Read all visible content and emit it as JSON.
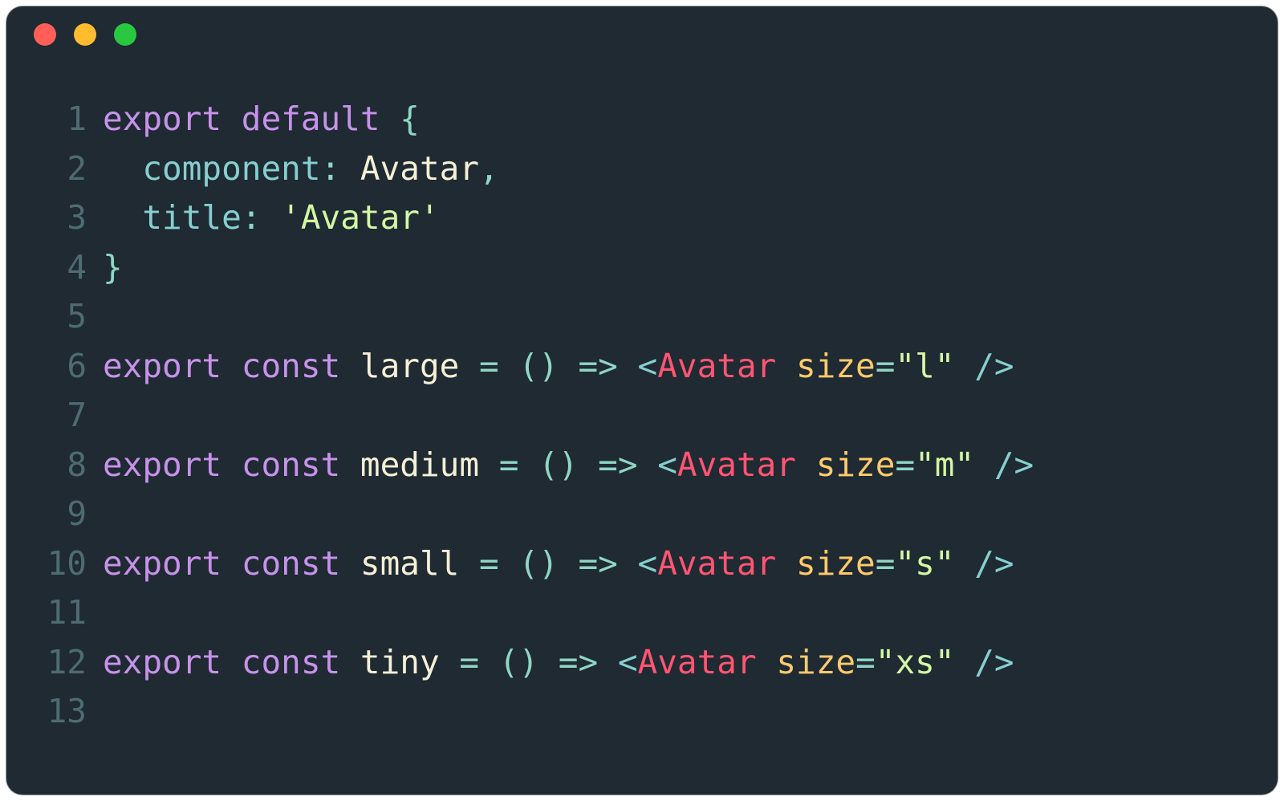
{
  "colors": {
    "background": "#1f2a33",
    "gutter": "#4f6b72",
    "keyword": "#c792ea",
    "key": "#86cfcf",
    "ident": "#f5f0d6",
    "punct": "#8fd6c4",
    "string": "#d4f7a4",
    "tagAngle": "#86cfcf",
    "tagName": "#ff5572",
    "attr": "#ffca6b",
    "text": "#e8ecee",
    "trafficRed": "#ff5f57",
    "trafficYellow": "#febc2e",
    "trafficGreen": "#28c840"
  },
  "lineNumbers": [
    "1",
    "2",
    "3",
    "4",
    "5",
    "6",
    "7",
    "8",
    "9",
    "10",
    "11",
    "12",
    "13"
  ],
  "code": {
    "l1": {
      "export": "export",
      "default": "default",
      "brace": "{"
    },
    "l2": {
      "indent": "  ",
      "key": "component",
      "colon": ":",
      "value": "Avatar",
      "comma": ","
    },
    "l3": {
      "indent": "  ",
      "key": "title",
      "colon": ":",
      "value": "'Avatar'"
    },
    "l4": {
      "brace": "}"
    },
    "l6": {
      "export": "export",
      "const": "const",
      "name": "large",
      "eq": "=",
      "parens": "()",
      "arrow": "=>",
      "lt": "<",
      "tag": "Avatar",
      "attr": "size",
      "aeq": "=",
      "val": "\"l\"",
      "close": "/>"
    },
    "l8": {
      "export": "export",
      "const": "const",
      "name": "medium",
      "eq": "=",
      "parens": "()",
      "arrow": "=>",
      "lt": "<",
      "tag": "Avatar",
      "attr": "size",
      "aeq": "=",
      "val": "\"m\"",
      "close": "/>"
    },
    "l10": {
      "export": "export",
      "const": "const",
      "name": "small",
      "eq": "=",
      "parens": "()",
      "arrow": "=>",
      "lt": "<",
      "tag": "Avatar",
      "attr": "size",
      "aeq": "=",
      "val": "\"s\"",
      "close": "/>"
    },
    "l12": {
      "export": "export",
      "const": "const",
      "name": "tiny",
      "eq": "=",
      "parens": "()",
      "arrow": "=>",
      "lt": "<",
      "tag": "Avatar",
      "attr": "size",
      "aeq": "=",
      "val": "\"xs\"",
      "close": "/>"
    }
  }
}
